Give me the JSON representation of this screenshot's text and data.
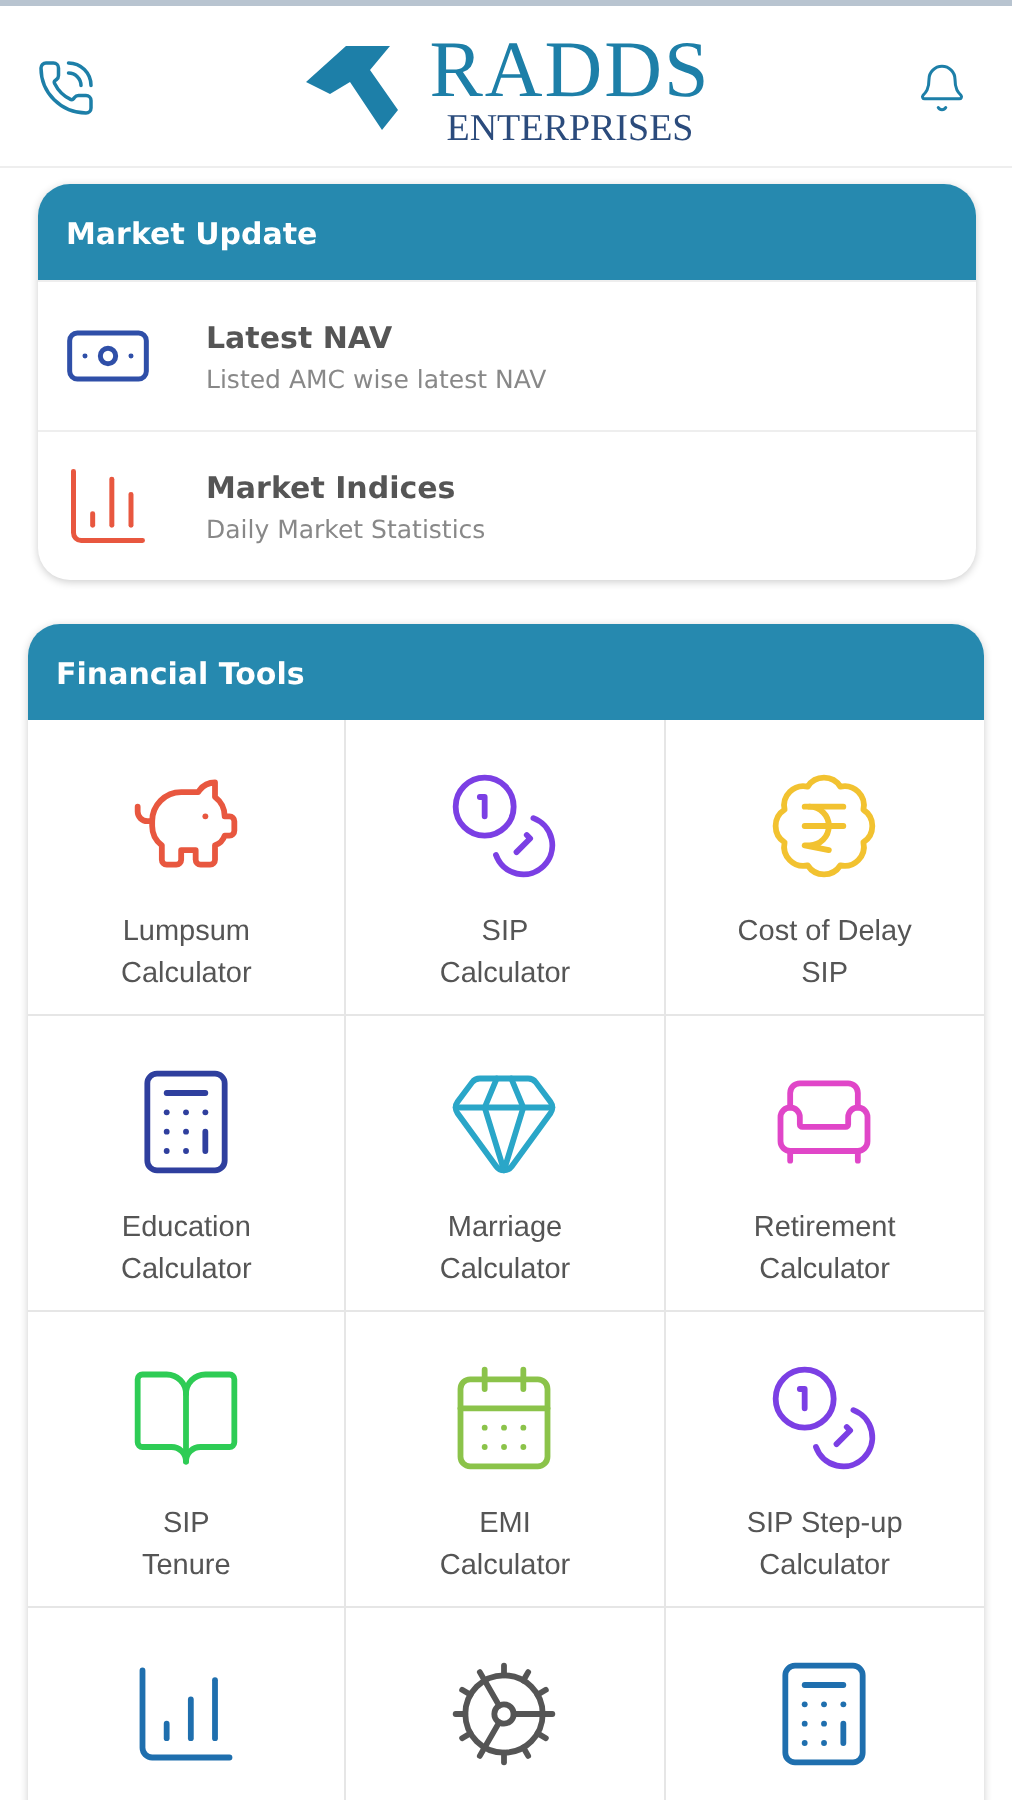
{
  "header": {
    "logo_title": "RADDS",
    "logo_subtitle": "ENTERPRISES"
  },
  "market_update": {
    "title": "Market Update",
    "items": [
      {
        "title": "Latest NAV",
        "subtitle": "Listed AMC wise latest NAV"
      },
      {
        "title": "Market Indices",
        "subtitle": "Daily Market Statistics"
      }
    ]
  },
  "financial_tools": {
    "title": "Financial Tools",
    "items": [
      {
        "label": [
          "Lumpsum",
          "Calculator"
        ],
        "color": "#e8573f"
      },
      {
        "label": [
          "SIP",
          "Calculator"
        ],
        "color": "#7b3fe4"
      },
      {
        "label": [
          "Cost of Delay",
          "SIP"
        ],
        "color": "#f2c230"
      },
      {
        "label": [
          "Education",
          "Calculator"
        ],
        "color": "#2f3f9e"
      },
      {
        "label": [
          "Marriage",
          "Calculator"
        ],
        "color": "#2aa6c8"
      },
      {
        "label": [
          "Retirement",
          "Calculator"
        ],
        "color": "#e046c8"
      },
      {
        "label": [
          "SIP",
          "Tenure"
        ],
        "color": "#2ecc55"
      },
      {
        "label": [
          "EMI",
          "Calculator"
        ],
        "color": "#8bc34a"
      },
      {
        "label": [
          "SIP Step-up",
          "Calculator"
        ],
        "color": "#7b3fe4"
      },
      {
        "color": "#1f6fae"
      },
      {
        "color": "#555555"
      },
      {
        "color": "#1f6fae"
      }
    ]
  }
}
